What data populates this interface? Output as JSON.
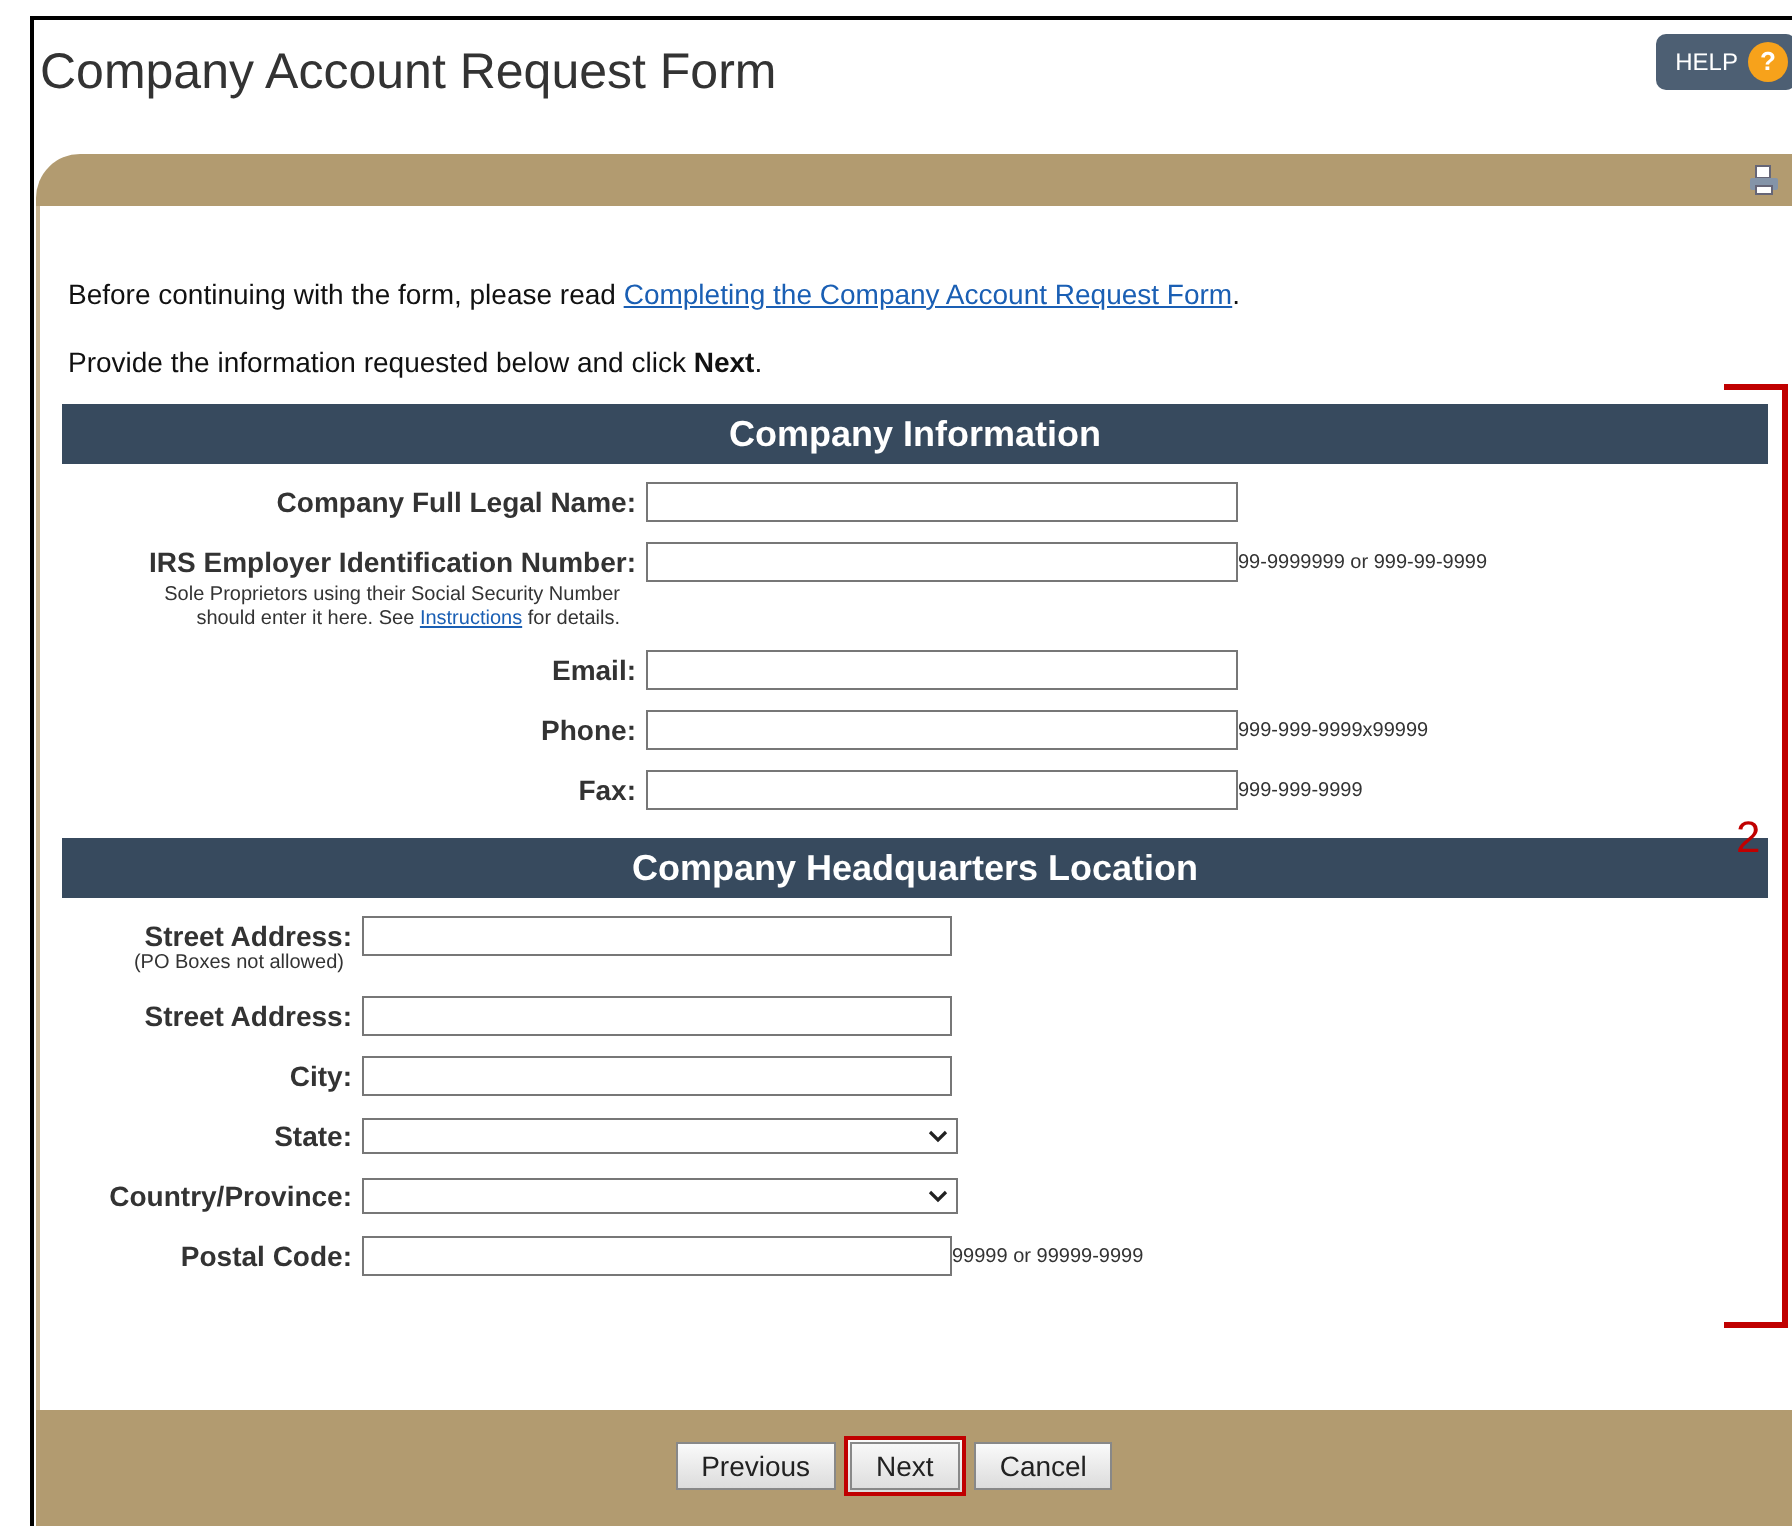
{
  "window": {
    "title": "Company Account Request Form"
  },
  "help_button": {
    "label": "HELP",
    "icon_text": "?"
  },
  "intro": {
    "before_link": "Before continuing with the form, please read ",
    "link": "Completing the Company Account Request Form",
    "after_link": "."
  },
  "instruction": "Provide the information requested below and click **Next**.",
  "sections": [
    {
      "title": "Company Information",
      "fields": [
        {
          "label": "Company Full Legal Name:",
          "kind": "text"
        },
        {
          "label": "IRS Employer Identification Number:",
          "kind": "text",
          "hint": "99-9999999 or 999-99-9999",
          "note": {
            "before_link": "Sole Proprietors using their Social Security Number should enter it here. See ",
            "link": "Instructions",
            "after_link": " for details."
          }
        },
        {
          "label": "Email:",
          "kind": "text"
        },
        {
          "label": "Phone:",
          "kind": "text",
          "hint": "999-999-9999x99999"
        },
        {
          "label": "Fax:",
          "kind": "text",
          "hint": "999-999-9999"
        }
      ]
    },
    {
      "title": "Company Headquarters Location",
      "fields": [
        {
          "label": "Street Address:",
          "kind": "text",
          "subnote": "(PO Boxes not allowed)"
        },
        {
          "label": "Street Address:",
          "kind": "text"
        },
        {
          "label": "City:",
          "kind": "text"
        },
        {
          "label": "State:",
          "kind": "select"
        },
        {
          "label": "Country/Province:",
          "kind": "select"
        },
        {
          "label": "Postal Code:",
          "kind": "text",
          "hint": "99999 or 99999-9999"
        }
      ]
    }
  ],
  "annotation": {
    "label": "2"
  },
  "buttons": [
    {
      "label": "Previous",
      "highlighted": false
    },
    {
      "label": "Next",
      "highlighted": true
    },
    {
      "label": "Cancel",
      "highlighted": false
    }
  ]
}
